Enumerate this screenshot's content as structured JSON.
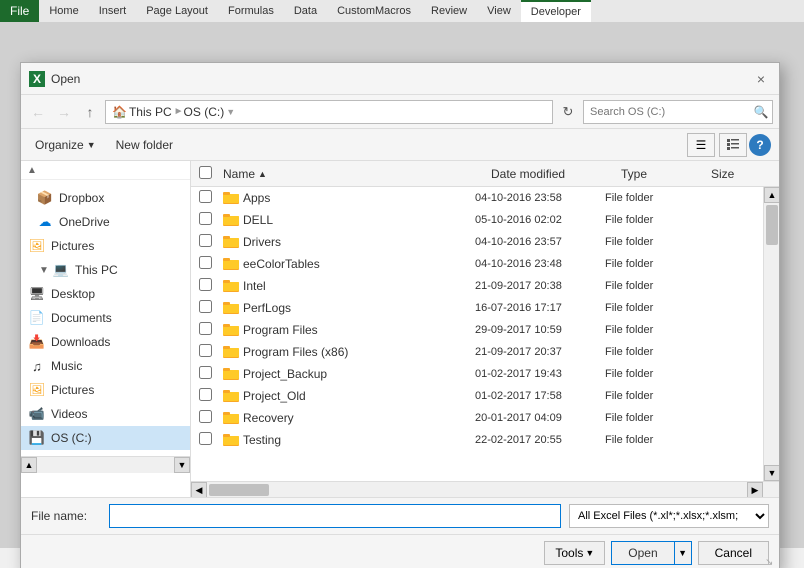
{
  "excel": {
    "ribbon_file": "File",
    "tabs": [
      "Home",
      "Insert",
      "Page Layout",
      "Formulas",
      "Data",
      "CustomMacros",
      "Review",
      "View",
      "Developer"
    ]
  },
  "dialog": {
    "icon_label": "X",
    "title": "Open",
    "close_label": "×",
    "breadcrumb": {
      "parts": [
        "This PC",
        "OS (C:)"
      ],
      "full": "This PC › OS (C:)"
    },
    "search_placeholder": "Search OS (C:)",
    "search_label": "Search OS",
    "toolbar": {
      "organize_label": "Organize",
      "new_folder_label": "New folder",
      "help_label": "?"
    },
    "columns": {
      "name": "Name",
      "date_modified": "Date modified",
      "type": "Type",
      "size": "Size"
    },
    "files": [
      {
        "name": "Apps",
        "date": "04-10-2016 23:58",
        "type": "File folder",
        "size": ""
      },
      {
        "name": "DELL",
        "date": "05-10-2016 02:02",
        "type": "File folder",
        "size": ""
      },
      {
        "name": "Drivers",
        "date": "04-10-2016 23:57",
        "type": "File folder",
        "size": ""
      },
      {
        "name": "eeColorTables",
        "date": "04-10-2016 23:48",
        "type": "File folder",
        "size": ""
      },
      {
        "name": "Intel",
        "date": "21-09-2017 20:38",
        "type": "File folder",
        "size": ""
      },
      {
        "name": "PerfLogs",
        "date": "16-07-2016 17:17",
        "type": "File folder",
        "size": ""
      },
      {
        "name": "Program Files",
        "date": "29-09-2017 10:59",
        "type": "File folder",
        "size": ""
      },
      {
        "name": "Program Files (x86)",
        "date": "21-09-2017 20:37",
        "type": "File folder",
        "size": ""
      },
      {
        "name": "Project_Backup",
        "date": "01-02-2017 19:43",
        "type": "File folder",
        "size": ""
      },
      {
        "name": "Project_Old",
        "date": "01-02-2017 17:58",
        "type": "File folder",
        "size": ""
      },
      {
        "name": "Recovery",
        "date": "20-01-2017 04:09",
        "type": "File folder",
        "size": ""
      },
      {
        "name": "Testing",
        "date": "22-02-2017 20:55",
        "type": "File folder",
        "size": ""
      }
    ],
    "sidebar": {
      "items": [
        {
          "id": "dropbox",
          "label": "Dropbox",
          "icon": "📦",
          "indent": 0
        },
        {
          "id": "onedrive",
          "label": "OneDrive",
          "icon": "☁",
          "indent": 0
        },
        {
          "id": "pictures-od",
          "label": "Pictures",
          "icon": "🖼",
          "indent": 1
        },
        {
          "id": "this-pc",
          "label": "This PC",
          "icon": "💻",
          "indent": 0
        },
        {
          "id": "desktop",
          "label": "Desktop",
          "icon": "🖥",
          "indent": 1
        },
        {
          "id": "documents",
          "label": "Documents",
          "icon": "📄",
          "indent": 1
        },
        {
          "id": "downloads",
          "label": "Downloads",
          "icon": "📥",
          "indent": 1
        },
        {
          "id": "music",
          "label": "Music",
          "icon": "♫",
          "indent": 1
        },
        {
          "id": "pictures",
          "label": "Pictures",
          "icon": "🖼",
          "indent": 1
        },
        {
          "id": "videos",
          "label": "Videos",
          "icon": "📹",
          "indent": 1
        },
        {
          "id": "os-c",
          "label": "OS (C:)",
          "icon": "💾",
          "indent": 1
        }
      ]
    },
    "bottom": {
      "filename_label": "File name:",
      "filename_value": "",
      "filetype_label": "All Excel Files (*.xl*;*.xlsx;*.xlsm;",
      "tools_label": "Tools",
      "open_label": "Open",
      "cancel_label": "Cancel"
    }
  }
}
